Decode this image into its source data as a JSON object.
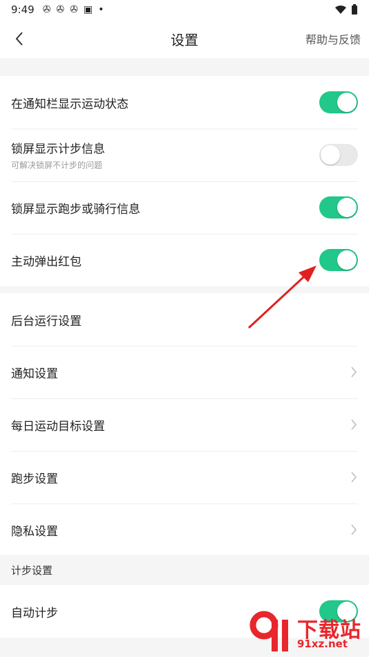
{
  "status_bar": {
    "time": "9:49"
  },
  "header": {
    "title": "设置",
    "help_label": "帮助与反馈"
  },
  "toggle_section": {
    "items": [
      {
        "label": "在通知栏显示运动状态",
        "sub": "",
        "on": true
      },
      {
        "label": "锁屏显示计步信息",
        "sub": "可解决锁屏不计步的问题",
        "on": false
      },
      {
        "label": "锁屏显示跑步或骑行信息",
        "sub": "",
        "on": true
      },
      {
        "label": "主动弹出红包",
        "sub": "",
        "on": true
      }
    ]
  },
  "settings_section": {
    "items": [
      {
        "label": "后台运行设置"
      },
      {
        "label": "通知设置"
      },
      {
        "label": "每日运动目标设置"
      },
      {
        "label": "跑步设置"
      },
      {
        "label": "隐私设置"
      }
    ]
  },
  "step_section": {
    "header": "计步设置",
    "items": [
      {
        "label": "自动计步",
        "on": true
      }
    ]
  },
  "watermark": {
    "text": "下载站",
    "url": "91xz.net"
  },
  "colors": {
    "toggle_on": "#22c78a",
    "toggle_off": "#e9e9e9",
    "arrow": "#e02020",
    "watermark": "#e8262c"
  }
}
